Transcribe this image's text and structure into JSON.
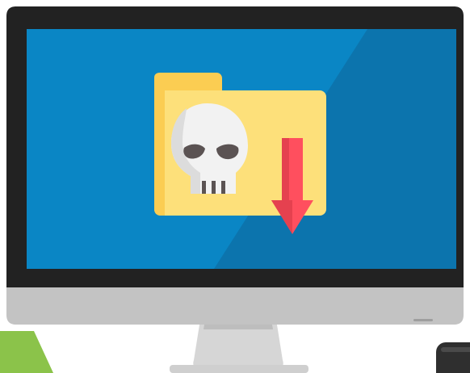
{
  "illustration": {
    "subject": "monitor-with-malware-download",
    "icons": [
      "monitor-icon",
      "folder-icon",
      "skull-icon",
      "download-arrow-icon"
    ]
  },
  "colors": {
    "bezel": "#222222",
    "screen": "#0a86c5",
    "screen_shade": "#0c74ad",
    "chin": "#c3c3c3",
    "stand": "#d9d9d9",
    "folder": "#fde07a",
    "folder_tab": "#fbcd52",
    "skull": "#f2f2f2",
    "skull_shade": "#d9d9d9",
    "skull_eyes": "#5b5353",
    "arrow": "#ff4f5e",
    "corner_accent": "#8bc34a",
    "corner_object": "#2f2f2f"
  }
}
